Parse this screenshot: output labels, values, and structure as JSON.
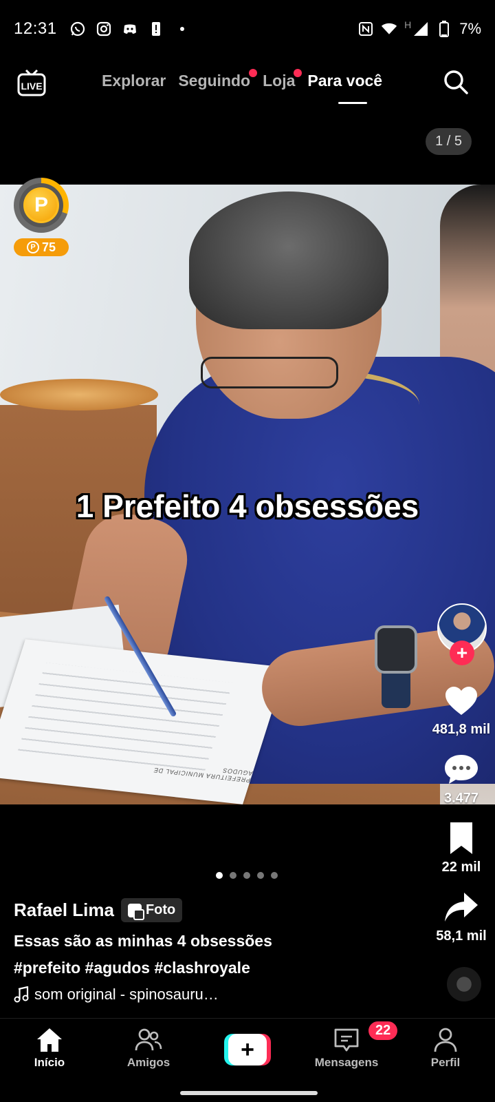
{
  "status_bar": {
    "time": "12:31",
    "left_icons": [
      "whatsapp-icon",
      "instagram-icon",
      "discord-icon",
      "alert-icon",
      "dot-icon"
    ],
    "right_icons": [
      "nfc-icon",
      "wifi-icon",
      "signal-icon",
      "battery-icon"
    ],
    "network_label": "H",
    "battery": "7%"
  },
  "top_nav": {
    "tabs": [
      {
        "label": "Explorar",
        "active": false,
        "dot": false
      },
      {
        "label": "Seguindo",
        "active": false,
        "dot": true
      },
      {
        "label": "Loja",
        "active": false,
        "dot": true
      },
      {
        "label": "Para você",
        "active": true,
        "dot": false
      }
    ]
  },
  "page_counter": "1 / 5",
  "coins": {
    "count": "75",
    "symbol": "P"
  },
  "photo": {
    "overlay_text": "1 Prefeito 4 obsessões",
    "paper_footer": "PREFEITURA MUNICIPAL DE AGUDOS"
  },
  "rail": {
    "likes": "481,8 mil",
    "comments": "3.477",
    "saves": "22 mil",
    "shares": "58,1 mil",
    "follow_symbol": "+"
  },
  "carousel": {
    "total": 5,
    "active_index": 0
  },
  "caption": {
    "author": "Rafael Lima",
    "badge": "Foto",
    "description": "Essas são as minhas 4 obsessões",
    "hashtags": "#prefeito #agudos #clashroyale",
    "sound": "som original - spinosauru…"
  },
  "bottom_nav": {
    "items": [
      {
        "label": "Início",
        "active": true
      },
      {
        "label": "Amigos",
        "active": false
      },
      {
        "label": "",
        "active": false
      },
      {
        "label": "Mensagens",
        "active": false
      },
      {
        "label": "Perfil",
        "active": false
      }
    ],
    "create_symbol": "+",
    "messages_badge": "22"
  },
  "colors": {
    "accent": "#fe2c55",
    "cyan": "#25f4ee",
    "coin": "#f59c0a"
  }
}
